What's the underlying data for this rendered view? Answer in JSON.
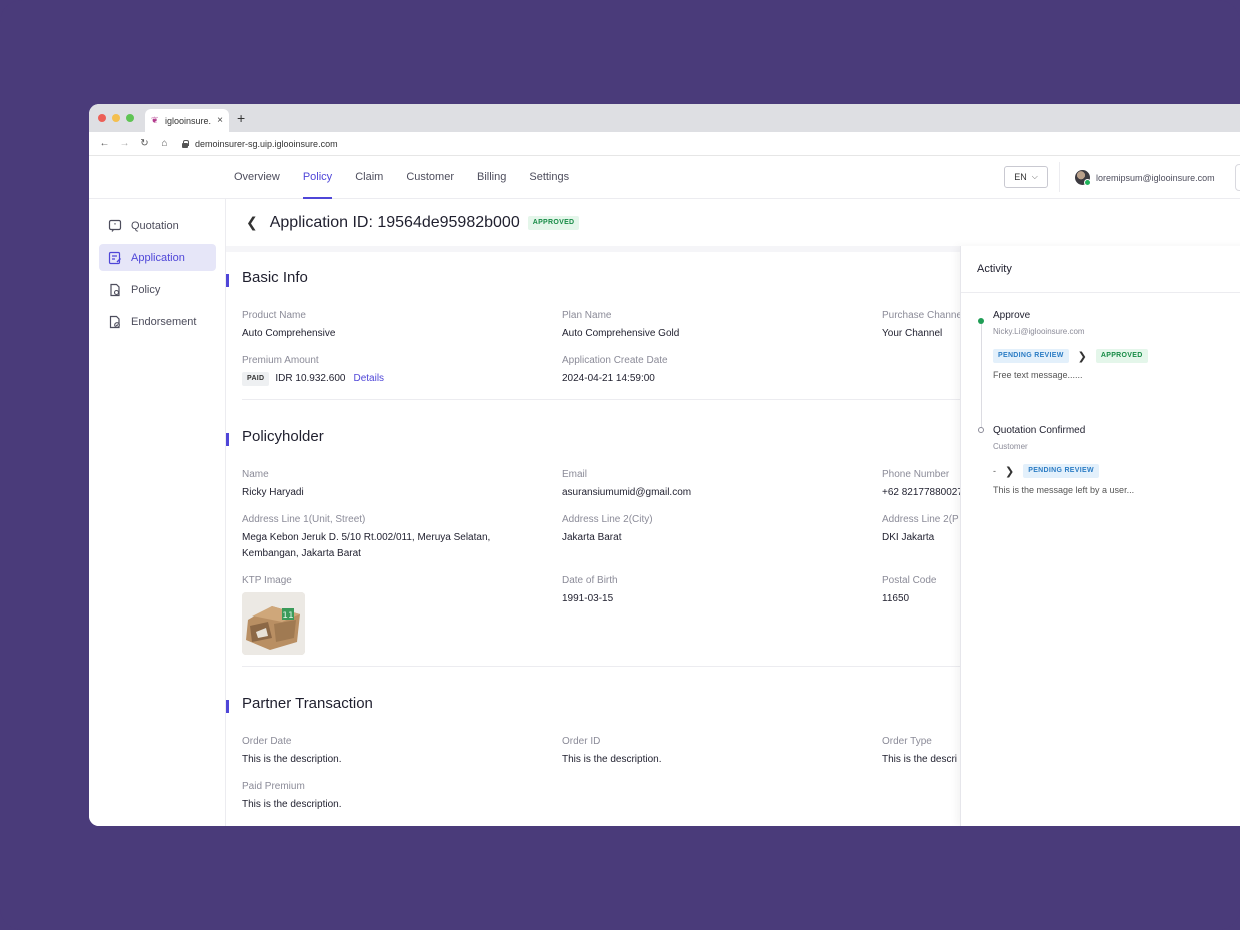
{
  "browser": {
    "tab_title": "iglooinsure.",
    "tab_close": "×",
    "new_tab": "+",
    "url": "demoinsurer-sg.uip.iglooinsure.com",
    "back": "←",
    "forward": "→",
    "reload": "↻",
    "home": "⌂"
  },
  "header": {
    "nav": [
      "Overview",
      "Policy",
      "Claim",
      "Customer",
      "Billing",
      "Settings"
    ],
    "active_nav": "Policy",
    "language": "EN",
    "user_email": "loremipsum@iglooinsure.com"
  },
  "sidebar": {
    "items": [
      {
        "label": "Quotation",
        "icon": "quote-icon"
      },
      {
        "label": "Application",
        "icon": "application-icon"
      },
      {
        "label": "Policy",
        "icon": "policy-icon"
      },
      {
        "label": "Endorsement",
        "icon": "endorsement-icon"
      }
    ],
    "active": "Application"
  },
  "page": {
    "title": "Application ID: 19564de95982b000",
    "status": "APPROVED"
  },
  "basic_info": {
    "title": "Basic Info",
    "product_name_label": "Product Name",
    "product_name": "Auto Comprehensive",
    "plan_name_label": "Plan Name",
    "plan_name": "Auto Comprehensive Gold",
    "purchase_channel_label": "Purchase Channe",
    "purchase_channel": "Your Channel",
    "premium_amount_label": "Premium Amount",
    "paid_tag": "PAID",
    "premium_amount": "IDR 10.932.600",
    "details_link": "Details",
    "create_date_label": "Application Create Date",
    "create_date": "2024-04-21 14:59:00"
  },
  "policyholder": {
    "title": "Policyholder",
    "name_label": "Name",
    "name": "Ricky Haryadi",
    "email_label": "Email",
    "email": "asuransiumumid@gmail.com",
    "phone_label": "Phone Number",
    "phone": "+62 82177880027",
    "address1_label": "Address Line 1(Unit, Street)",
    "address1_line1": "Mega Kebon Jeruk D. 5/10 Rt.002/011, Meruya Selatan,",
    "address1_line2": "Kembangan, Jakarta Barat",
    "address2_label": "Address Line 2(City)",
    "address2": "Jakarta Barat",
    "address3_label": "Address Line 2(P",
    "address3": "DKI Jakarta",
    "ktp_label": "KTP Image",
    "dob_label": "Date of Birth",
    "dob": "1991-03-15",
    "postal_label": "Postal Code",
    "postal": "11650"
  },
  "partner_transaction": {
    "title": "Partner Transaction",
    "order_date_label": "Order Date",
    "order_date": "This is the description.",
    "order_id_label": "Order ID",
    "order_id": "This is the description.",
    "order_type_label": "Order Type",
    "order_type": "This is the descri",
    "paid_premium_label": "Paid Premium",
    "paid_premium": "This is the description."
  },
  "activity": {
    "title": "Activity",
    "entries": [
      {
        "name": "Approve",
        "by": "Nicky.Li@iglooinsure.com",
        "from": "PENDING REVIEW",
        "to": "APPROVED",
        "message": "Free text message......",
        "dot_color": "#1f9d55"
      },
      {
        "name": "Quotation Confirmed",
        "by": "Customer",
        "from": "-",
        "to": "PENDING REVIEW",
        "message": "This is the message left by a user...",
        "dot_color": "#8b8b98"
      }
    ]
  },
  "colors": {
    "background": "#4a3b7a",
    "accent": "#4f46d8",
    "approved": "#178b46",
    "pending": "#2b7cc4"
  }
}
